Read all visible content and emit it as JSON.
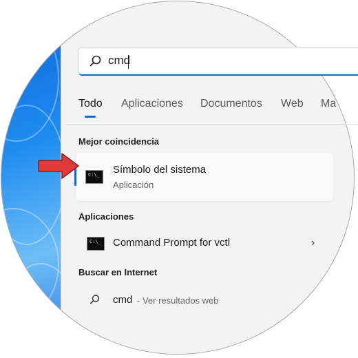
{
  "search": {
    "value": "cmd"
  },
  "tabs": [
    {
      "label": "Todo"
    },
    {
      "label": "Aplicaciones"
    },
    {
      "label": "Documentos"
    },
    {
      "label": "Web"
    },
    {
      "label": "Ma"
    }
  ],
  "best_match": {
    "heading": "Mejor coincidencia",
    "title": "Símbolo del sistema",
    "subtitle": "Aplicación",
    "icon": "cmd-icon",
    "icon_text": "C:\\_"
  },
  "apps": {
    "heading": "Aplicaciones",
    "items": [
      {
        "label": "Command Prompt for vctl",
        "icon": "cmd-icon",
        "icon_text": "C:\\_"
      }
    ]
  },
  "web": {
    "heading": "Buscar en Internet",
    "query": "cmd",
    "suffix": "- Ver resultados web"
  },
  "colors": {
    "accent": "#1a66c9",
    "arrow": "#e0393b",
    "panel": "#f3f3f3"
  }
}
